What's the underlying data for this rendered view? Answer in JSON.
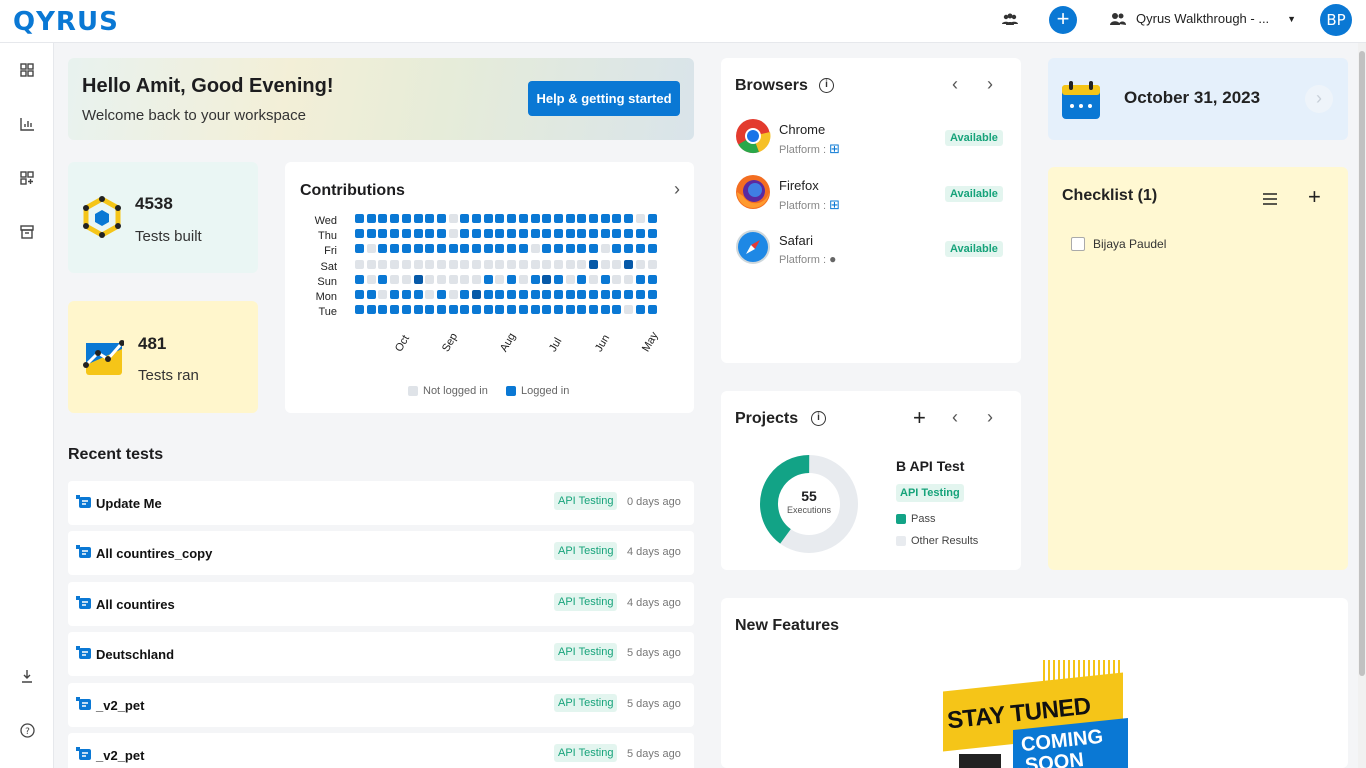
{
  "app": {
    "logo": "QYRUS",
    "workspace": "Qyrus Walkthrough - ...",
    "avatar_initials": "BP",
    "accent": "#0a78d4"
  },
  "sidebar": {
    "items": [
      "dashboard-icon",
      "reports-icon",
      "apps-add-icon",
      "archive-icon",
      "download-icon",
      "help-icon"
    ]
  },
  "greeting": {
    "title": "Hello Amit, Good Evening!",
    "subtitle": "Welcome back to your workspace",
    "help_button": "Help & getting started"
  },
  "stats": {
    "built": {
      "value": "4538",
      "label": "Tests built"
    },
    "ran": {
      "value": "481",
      "label": "Tests ran"
    }
  },
  "contributions": {
    "title": "Contributions",
    "days": [
      "Wed",
      "Thu",
      "Fri",
      "Sat",
      "Sun",
      "Mon",
      "Tue"
    ],
    "months": [
      "Oct",
      "Sep",
      "Aug",
      "Jul",
      "Jun",
      "May"
    ],
    "legend_not": "Not logged in",
    "legend_logged": "Logged in",
    "grid": [
      "11111111011111111111111101",
      "11111111011111111111111111",
      "10111111111111101111101111",
      "00000000000000000000100100",
      "10100100000101010101010011",
      "11011101011111111111111111",
      "11111111111111111111111011"
    ],
    "dark_cells": [
      [
        3,
        20
      ],
      [
        3,
        23
      ],
      [
        4,
        5
      ],
      [
        5,
        10
      ],
      [
        4,
        16
      ]
    ]
  },
  "recent": {
    "title": "Recent tests",
    "items": [
      {
        "name": "Update Me",
        "tag": "API Testing",
        "ago": "0 days ago"
      },
      {
        "name": "All countires_copy",
        "tag": "API Testing",
        "ago": "4 days ago"
      },
      {
        "name": "All countires",
        "tag": "API Testing",
        "ago": "4 days ago"
      },
      {
        "name": "Deutschland",
        "tag": "API Testing",
        "ago": "5 days ago"
      },
      {
        "name": "_v2_pet",
        "tag": "API Testing",
        "ago": "5 days ago"
      },
      {
        "name": "_v2_pet",
        "tag": "API Testing",
        "ago": "5 days ago"
      }
    ]
  },
  "browsers": {
    "title": "Browsers",
    "items": [
      {
        "name": "Chrome",
        "platform": "Platform :",
        "status": "Available"
      },
      {
        "name": "Firefox",
        "platform": "Platform :",
        "status": "Available"
      },
      {
        "name": "Safari",
        "platform": "Platform :",
        "status": "Available"
      }
    ]
  },
  "projects": {
    "title": "Projects",
    "executions": "55",
    "executions_label": "Executions",
    "project_name": "B API Test",
    "tag": "API Testing",
    "pass_label": "Pass",
    "other_label": "Other Results",
    "pass_fraction": 0.4
  },
  "new_features": {
    "title": "New Features",
    "banner_1": "STAY TUNED",
    "banner_2": "COMING",
    "banner_3": "SOON"
  },
  "date": {
    "text": "October 31, 2023"
  },
  "checklist": {
    "title": "Checklist (1)",
    "items": [
      {
        "label": "Bijaya Paudel",
        "checked": false
      }
    ]
  }
}
